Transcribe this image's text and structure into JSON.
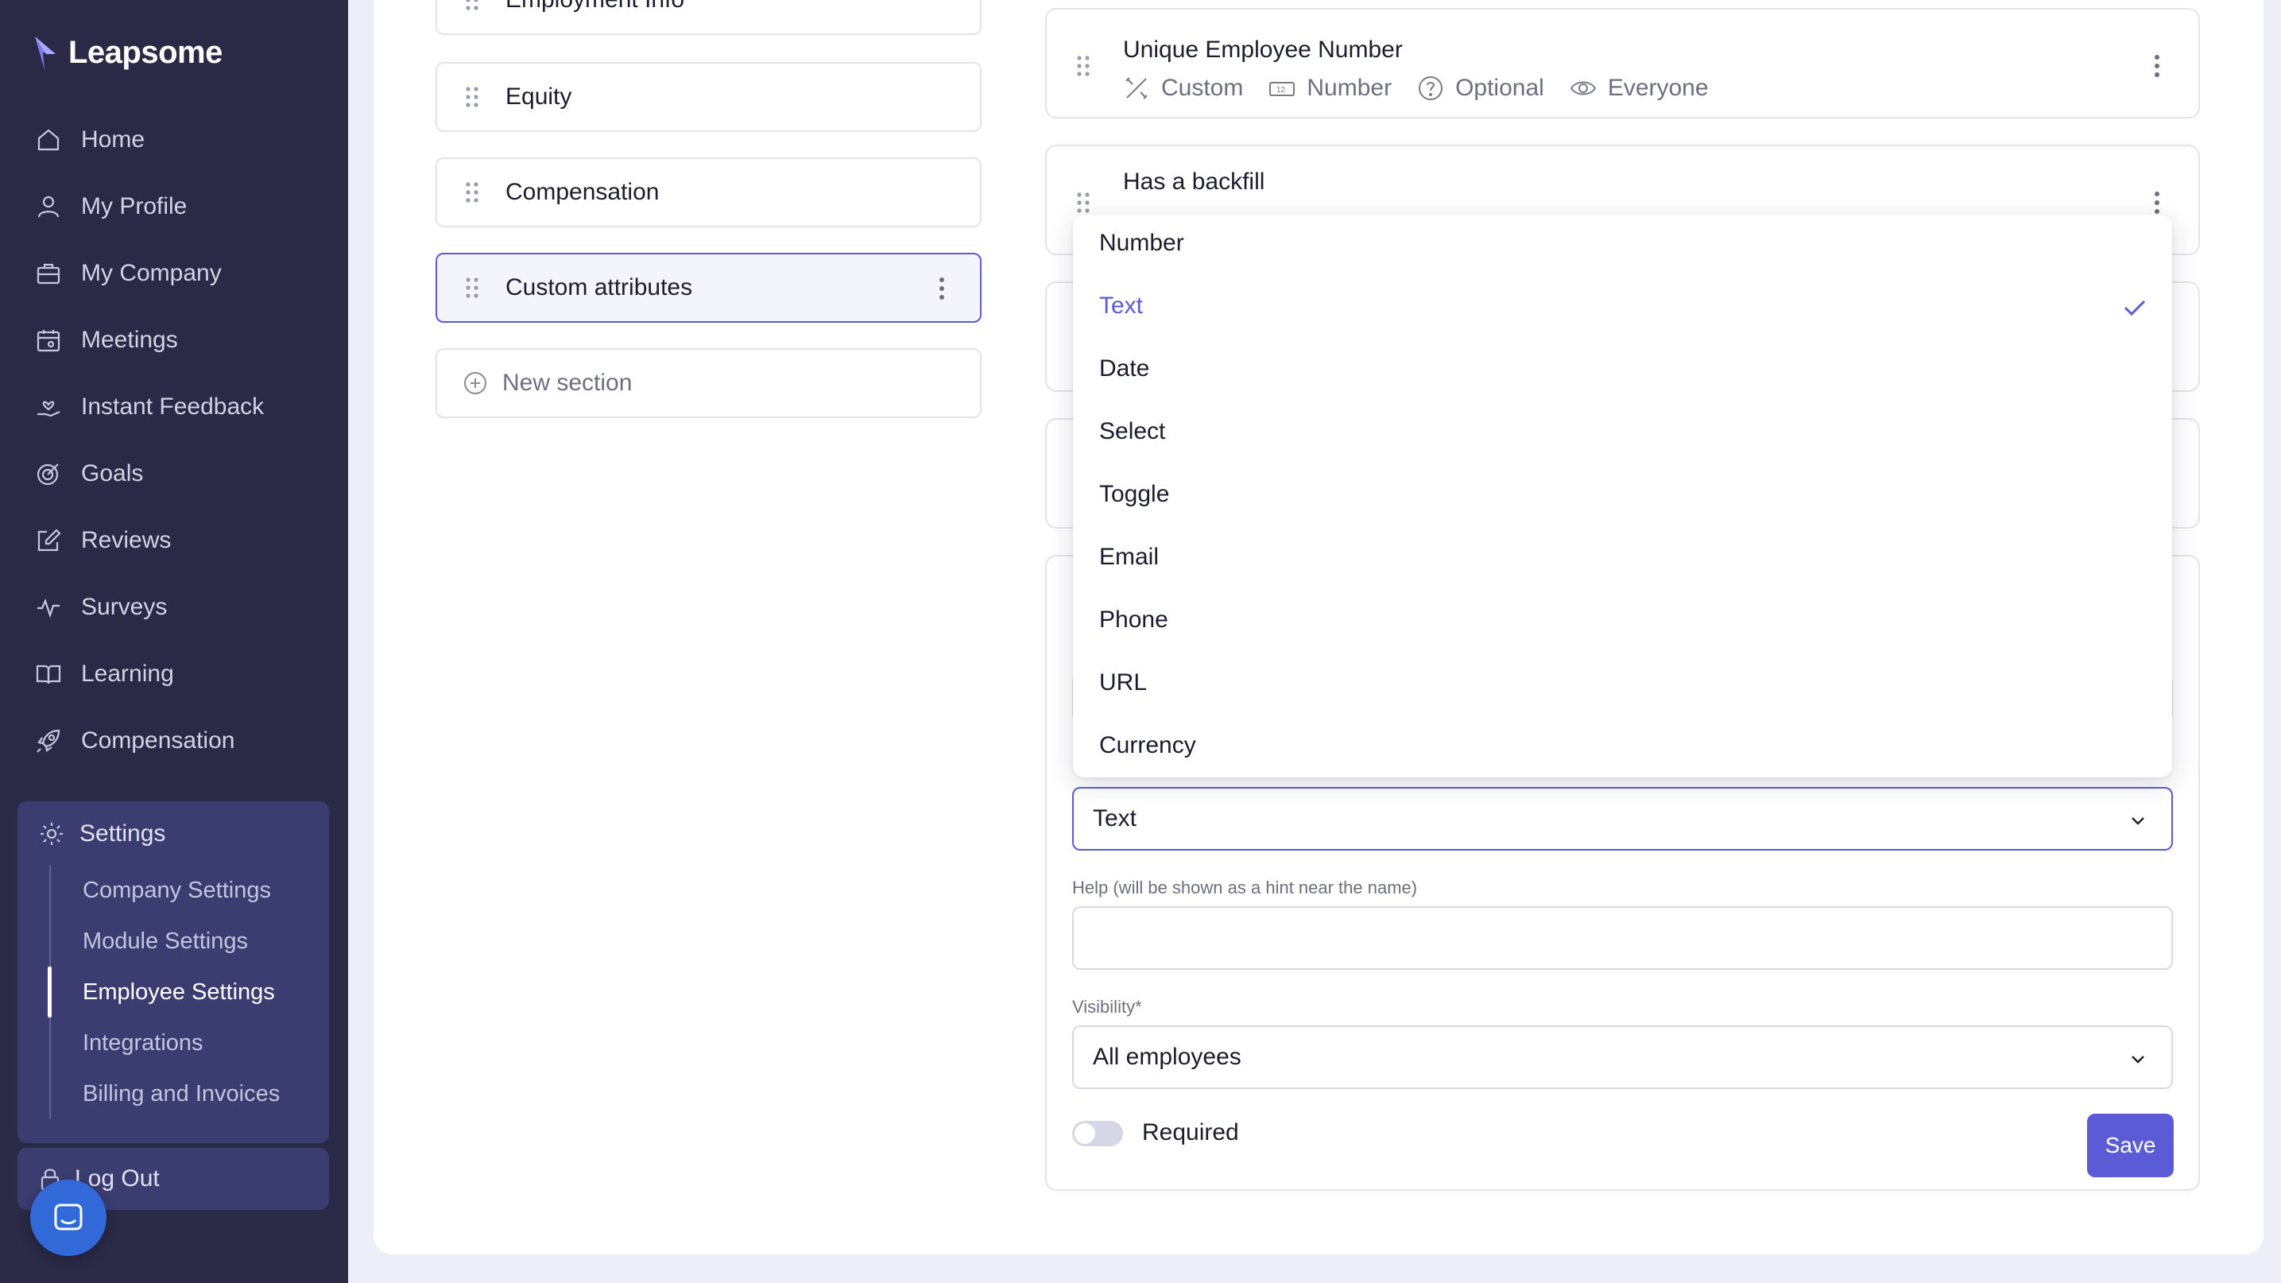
{
  "app": {
    "brand": "Leapsome"
  },
  "colors": {
    "accent": "#5b5bd6",
    "sidebar_bg": "#2a2a47",
    "settings_bg": "#3b3d71"
  },
  "sidebar": {
    "items": [
      {
        "label": "Home",
        "icon": "home-icon"
      },
      {
        "label": "My Profile",
        "icon": "user-icon"
      },
      {
        "label": "My Company",
        "icon": "briefcase-icon"
      },
      {
        "label": "Meetings",
        "icon": "calendar-icon"
      },
      {
        "label": "Instant Feedback",
        "icon": "hand-heart-icon"
      },
      {
        "label": "Goals",
        "icon": "target-icon"
      },
      {
        "label": "Reviews",
        "icon": "edit-icon"
      },
      {
        "label": "Surveys",
        "icon": "pulse-icon"
      },
      {
        "label": "Learning",
        "icon": "book-icon"
      },
      {
        "label": "Compensation",
        "icon": "rocket-icon"
      }
    ],
    "settings": {
      "label": "Settings",
      "sub_items": [
        "Company Settings",
        "Module Settings",
        "Employee Settings",
        "Integrations",
        "Billing and Invoices"
      ],
      "active": "Employee Settings"
    },
    "logout": "Log Out"
  },
  "sections": {
    "items": [
      "Employment Info",
      "Equity",
      "Compensation",
      "Custom attributes"
    ],
    "selected": "Custom attributes",
    "new_section": "New section"
  },
  "fields": [
    {
      "title": "Unique Employee Number",
      "meta": [
        {
          "icon": "tools-icon",
          "text": "Custom"
        },
        {
          "icon": "number-icon",
          "text": "Number"
        },
        {
          "icon": "question-icon",
          "text": "Optional"
        },
        {
          "icon": "eye-icon",
          "text": "Everyone"
        }
      ]
    },
    {
      "title": "Has a backfill"
    }
  ],
  "form": {
    "type_value": "Text",
    "help_label": "Help (will be shown as a hint near the name)",
    "help_value": "",
    "visibility_label": "Visibility*",
    "visibility_value": "All employees",
    "required_label": "Required",
    "required_on": false,
    "save_label": "Save"
  },
  "dropdown": {
    "options": [
      "Number",
      "Text",
      "Date",
      "Select",
      "Toggle",
      "Email",
      "Phone",
      "URL",
      "Currency"
    ],
    "selected": "Text"
  }
}
